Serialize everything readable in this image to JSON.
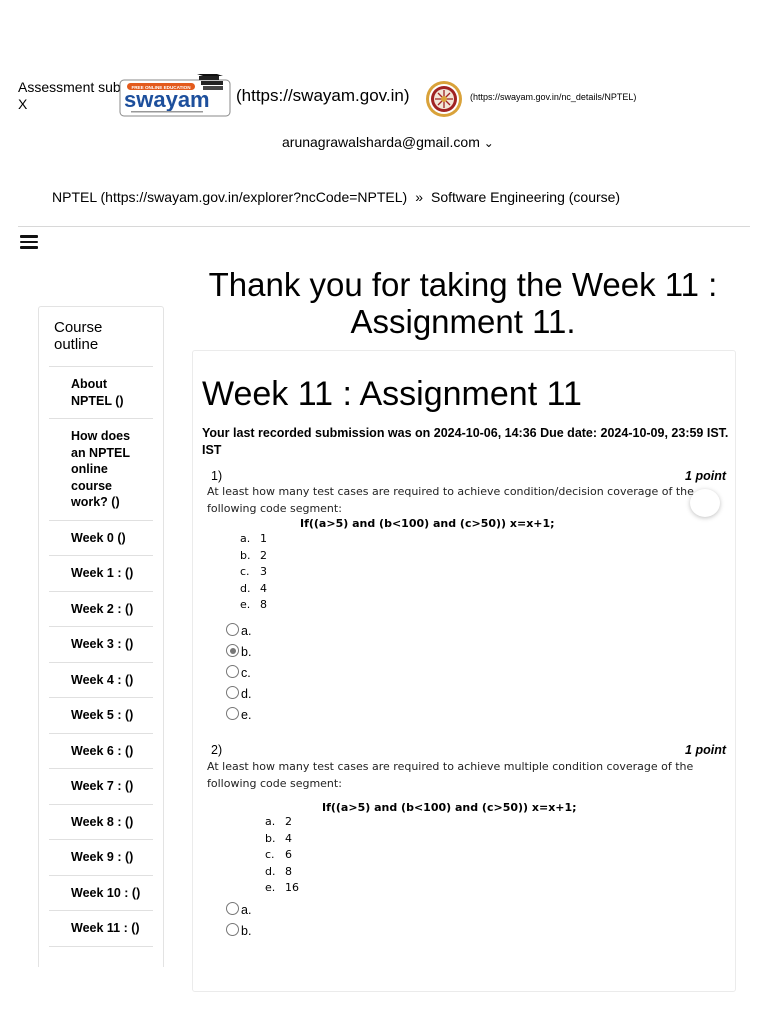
{
  "tab": {
    "title": "Assessment sub",
    "close": "X"
  },
  "header": {
    "swayam_logo_tagline": "FREE ONLINE EDUCATION",
    "swayam_logo_word": "swayam",
    "swayam_url": "(https://swayam.gov.in)",
    "nptel_url": "(https://swayam.gov.in/nc_details/NPTEL)",
    "user_email": "arunagrawalsharda@gmail.com",
    "user_chevron": "⌄"
  },
  "breadcrumb": {
    "link": "NPTEL (https://swayam.gov.in/explorer?ncCode=NPTEL)",
    "separator": "»",
    "current": "Software Engineering (course)"
  },
  "thanks_message": "Thank you for taking the Week 11 : Assignment 11.",
  "sidebar": {
    "title": "Course outline",
    "items": [
      "About NPTEL ()",
      "How does an NPTEL online course work? ()",
      "Week 0 ()",
      "Week 1 : ()",
      "Week 2 : ()",
      "Week 3 : ()",
      "Week 4 : ()",
      "Week 5 : ()",
      "Week 6 : ()",
      "Week 7 : ()",
      "Week 8 : ()",
      "Week 9 : ()",
      "Week 10 : ()",
      "Week 11 : ()"
    ]
  },
  "assignment": {
    "title": "Week 11 : Assignment 11",
    "submission_info": "Your last recorded submission was on 2024-10-06, 14:36  Due date: 2024-10-09, 23:59 IST.",
    "submission_info_tail": "IST",
    "questions": [
      {
        "number": "1)",
        "points": "1 point",
        "text": "At least how many test cases are required to achieve condition/decision coverage of the following code segment:",
        "code": "If((a>5) and (b<100) and (c>50))  x=x+1;",
        "choices": [
          {
            "letter": "a.",
            "value": "1"
          },
          {
            "letter": "b.",
            "value": "2"
          },
          {
            "letter": "c.",
            "value": "3"
          },
          {
            "letter": "d.",
            "value": "4"
          },
          {
            "letter": "e.",
            "value": "8"
          }
        ],
        "radios": [
          "a.",
          "b.",
          "c.",
          "d.",
          "e."
        ],
        "selected": "b."
      },
      {
        "number": "2)",
        "points": "1 point",
        "text": "At least how many test cases are required to achieve multiple condition coverage of the following code segment:",
        "code": "If((a>5) and (b<100) and (c>50))  x=x+1;",
        "choices": [
          {
            "letter": "a.",
            "value": "2"
          },
          {
            "letter": "b.",
            "value": "4"
          },
          {
            "letter": "c.",
            "value": "6"
          },
          {
            "letter": "d.",
            "value": "8"
          },
          {
            "letter": "e.",
            "value": "16"
          }
        ],
        "radios": [
          "a.",
          "b."
        ],
        "selected": ""
      }
    ]
  },
  "colors": {
    "swayam_blue": "#1d4f9c",
    "swayam_orange": "#e35a1c",
    "nptel_red": "#a02323",
    "nptel_gold": "#d9a23a"
  }
}
